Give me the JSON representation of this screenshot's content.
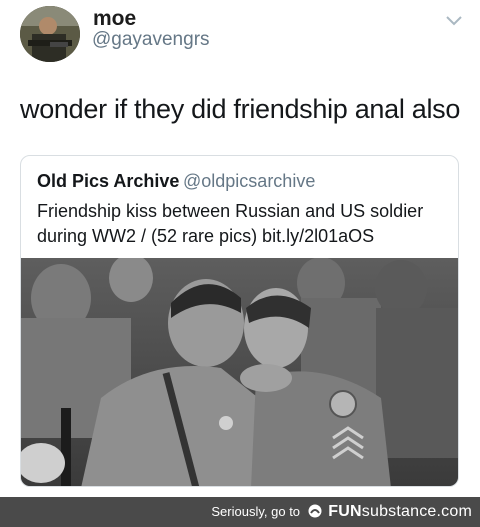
{
  "tweet": {
    "author_name": "moe",
    "author_handle": "@gayavengrs",
    "text": "wonder if they did friendship anal also",
    "menu_icon": "chevron-down-icon",
    "avatar_icon": "avatar"
  },
  "quoted_tweet": {
    "author_name": "Old Pics Archive",
    "author_handle": "@oldpicsarchive",
    "text": "Friendship kiss between Russian and US soldier during WW2 / (52 rare pics)  bit.ly/2l01aOS",
    "photo": "black-and-white-photo"
  },
  "footer": {
    "prefix": "Seriously, go to",
    "brand_bold": "FUN",
    "brand_light": "substance",
    "brand_suffix": ".com",
    "icon": "funsubstance-icon"
  },
  "colors": {
    "text": "#14171a",
    "secondary": "#657786",
    "border": "#d9dee2",
    "footer_bg": "#4a4a4a"
  }
}
